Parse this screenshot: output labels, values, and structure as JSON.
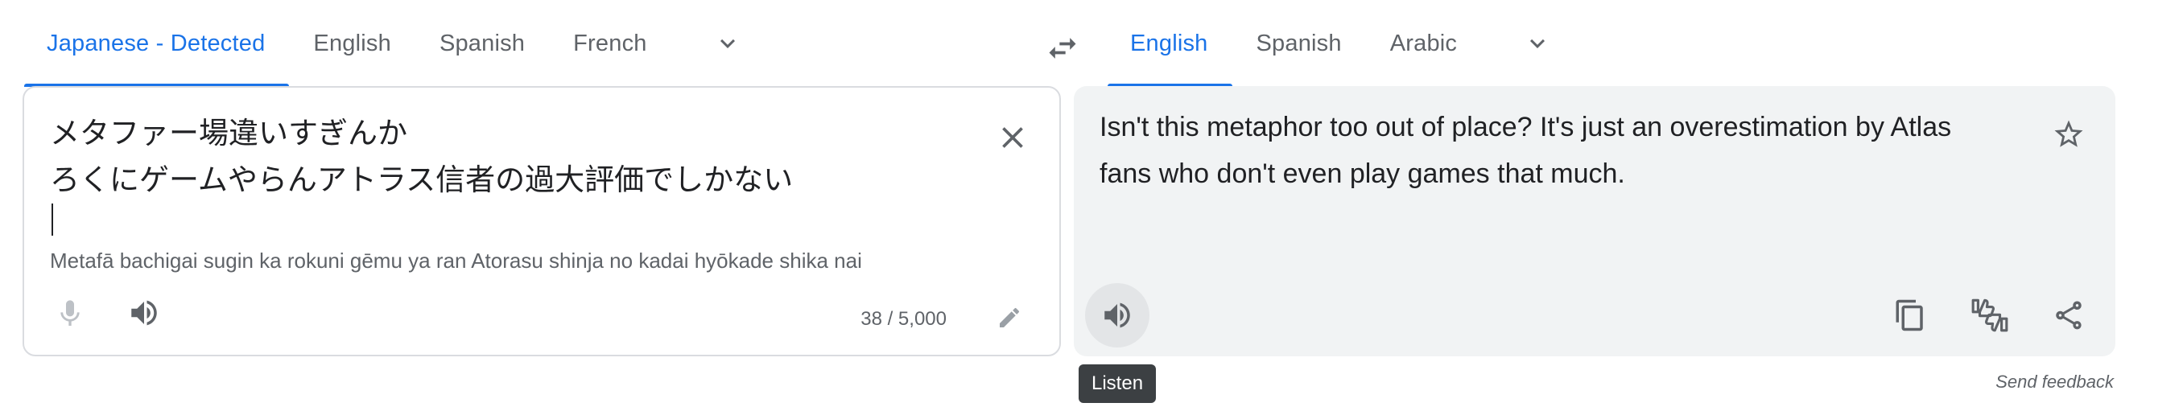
{
  "source": {
    "tabs": [
      {
        "label": "Japanese - Detected",
        "active": true
      },
      {
        "label": "English",
        "active": false
      },
      {
        "label": "Spanish",
        "active": false
      },
      {
        "label": "French",
        "active": false
      }
    ],
    "text_lines": [
      "メタファー場違いすぎんか",
      "ろくにゲームやらんアトラス信者の過大評価でしかない"
    ],
    "romanization": "Metafā bachigai sugin ka rokuni gēmu ya ran Atorasu shinja no kadai hyōkade shika nai",
    "char_count": "38 / 5,000"
  },
  "target": {
    "tabs": [
      {
        "label": "English",
        "active": true
      },
      {
        "label": "Spanish",
        "active": false
      },
      {
        "label": "Arabic",
        "active": false
      }
    ],
    "text": "Isn't this metaphor too out of place? It's just an overestimation by Atlas fans who don't even play games that much."
  },
  "tooltip": "Listen",
  "feedback_link": "Send feedback",
  "colors": {
    "accent": "#1a73e8",
    "icon": "#5f6368",
    "mic_disabled": "#bdc1c6",
    "target_panel_bg": "#f1f3f4"
  },
  "icons": [
    "chevron-down-icon",
    "swap-icon",
    "close-icon",
    "microphone-icon",
    "speaker-icon",
    "edit-icon",
    "star-icon",
    "copy-icon",
    "feedback-thumbs-icon",
    "share-icon"
  ]
}
